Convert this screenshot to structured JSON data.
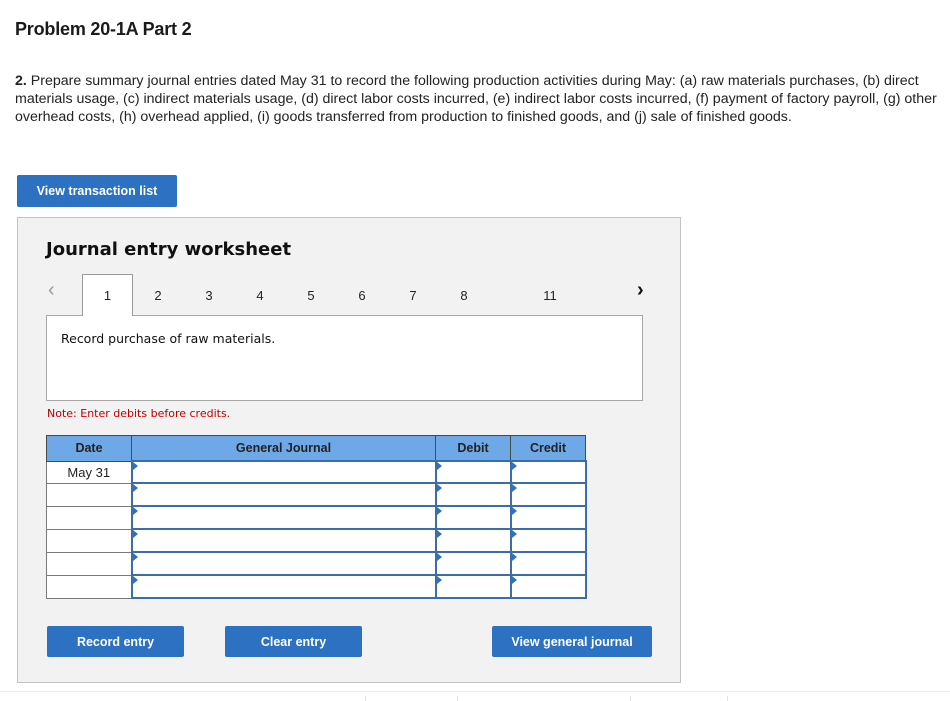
{
  "page": {
    "title": "Problem 20-1A Part 2",
    "prompt_number": "2.",
    "prompt_text": " Prepare summary journal entries dated May 31 to record the following production activities during May: (a) raw materials purchases, (b) direct materials usage, (c) indirect materials usage, (d) direct labor costs incurred, (e) indirect labor costs incurred, (f) payment of factory payroll, (g) other overhead costs, (h) overhead applied, (i) goods transferred from production to finished goods, and (j) sale of finished goods."
  },
  "buttons": {
    "view_transaction_list": "View transaction list",
    "record_entry": "Record entry",
    "clear_entry": "Clear entry",
    "view_general_journal": "View general journal"
  },
  "worksheet": {
    "title": "Journal entry worksheet",
    "nav_prev_icon": "‹",
    "nav_next_icon": "›",
    "tabs": [
      "1",
      "2",
      "3",
      "4",
      "5",
      "6",
      "7",
      "8",
      "11"
    ],
    "active_tab": "1",
    "description": "Record purchase of raw materials.",
    "note": "Note: Enter debits before credits."
  },
  "journal": {
    "headers": {
      "date": "Date",
      "account": "General Journal",
      "debit": "Debit",
      "credit": "Credit"
    },
    "rows": [
      {
        "date": "May 31",
        "account": "",
        "debit": "",
        "credit": ""
      },
      {
        "date": "",
        "account": "",
        "debit": "",
        "credit": ""
      },
      {
        "date": "",
        "account": "",
        "debit": "",
        "credit": ""
      },
      {
        "date": "",
        "account": "",
        "debit": "",
        "credit": ""
      },
      {
        "date": "",
        "account": "",
        "debit": "",
        "credit": ""
      },
      {
        "date": "",
        "account": "",
        "debit": "",
        "credit": ""
      }
    ]
  }
}
